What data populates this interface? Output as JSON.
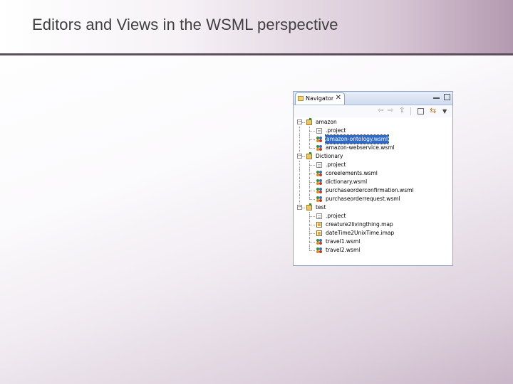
{
  "slide": {
    "title": "Editors and Views in the WSML perspective"
  },
  "colors": {
    "title_rule": "#5e4d5d",
    "selection": "#316ac5",
    "view_border": "#8fa6c8"
  },
  "navigator": {
    "tab_label": "Navigator",
    "tab_icon": "navigator-folder-icon",
    "close_glyph": "✕",
    "toolbar": {
      "back_glyph": "⇦",
      "forward_glyph": "⇨",
      "up_glyph": "⇪",
      "link_glyph": "⇆",
      "menu_glyph": "▼"
    },
    "projects": [
      {
        "name": "amazon",
        "expanded": true,
        "children": [
          {
            "name": ".project",
            "icon": "file-icon"
          },
          {
            "name": "amazon-ontology.wsml",
            "icon": "wsml-file-icon",
            "selected": true
          },
          {
            "name": "amazon-webservice.wsml",
            "icon": "wsml-file-icon"
          }
        ]
      },
      {
        "name": "Dictionary",
        "expanded": true,
        "children": [
          {
            "name": ".project",
            "icon": "file-icon"
          },
          {
            "name": "coreelements.wsml",
            "icon": "wsml-file-icon"
          },
          {
            "name": "dictionary.wsml",
            "icon": "wsml-file-icon"
          },
          {
            "name": "purchaseorderconfirmation.wsml",
            "icon": "wsml-file-icon"
          },
          {
            "name": "purchaseorderrequest.wsml",
            "icon": "wsml-file-icon"
          }
        ]
      },
      {
        "name": "test",
        "expanded": true,
        "children": [
          {
            "name": ".project",
            "icon": "file-icon"
          },
          {
            "name": "creature2livingthing.map",
            "icon": "mapping-file-icon"
          },
          {
            "name": "dateTime2UnixTime.imap",
            "icon": "mapping-file-icon"
          },
          {
            "name": "travel1.wsml",
            "icon": "wsml-file-icon"
          },
          {
            "name": "travel2.wsml",
            "icon": "wsml-file-icon"
          }
        ]
      }
    ]
  }
}
